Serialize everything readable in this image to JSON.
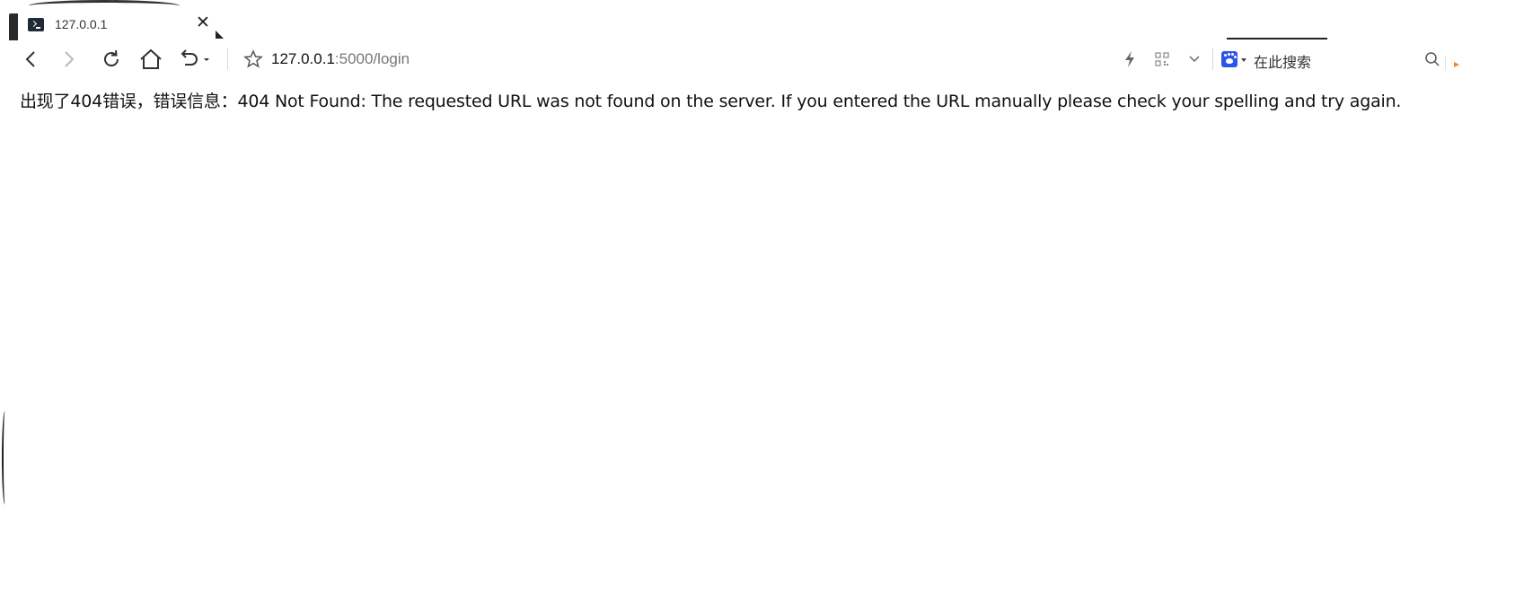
{
  "tab": {
    "title": "127.0.0.1",
    "close_icon": "close-icon",
    "favicon": "terminal-icon"
  },
  "toolbar": {
    "back_icon": "chevron-left-icon",
    "forward_icon": "chevron-right-icon",
    "reload_icon": "reload-icon",
    "home_icon": "home-icon",
    "undo_icon": "undo-icon",
    "bookmark_icon": "star-icon",
    "lightning_icon": "lightning-icon",
    "qr_icon": "qr-code-icon",
    "dropdown_icon": "chevron-down-icon"
  },
  "address_bar": {
    "host": "127.0.0.1",
    "path": ":5000/login"
  },
  "search": {
    "engine_icon": "baidu-paw-icon",
    "placeholder": "在此搜索",
    "search_icon": "search-icon"
  },
  "page": {
    "message": "出现了404错误，错误信息：404 Not Found: The requested URL was not found on the server. If you entered the URL manually please check your spelling and try again."
  },
  "colors": {
    "search_engine_blue": "#2b56e6",
    "accent_orange": "#f08a1c"
  }
}
